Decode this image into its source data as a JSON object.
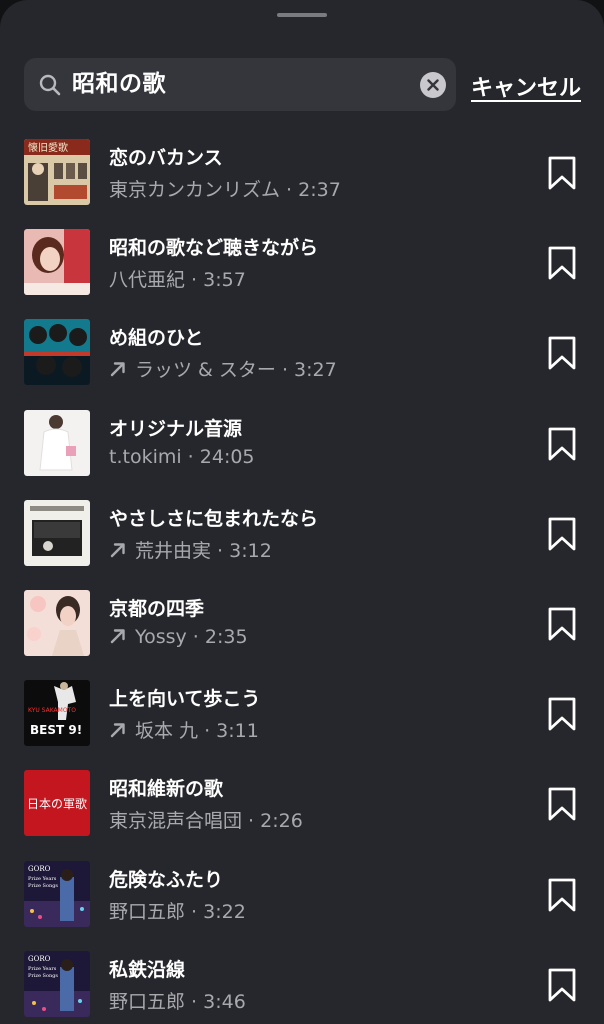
{
  "search": {
    "query": "昭和の歌",
    "cancel_label": "キャンセル"
  },
  "songs": [
    {
      "title": "恋のバカンス",
      "artist": "東京カンカンリズム",
      "duration": "2:37",
      "trending": false
    },
    {
      "title": "昭和の歌など聴きながら",
      "artist": "八代亜紀",
      "duration": "3:57",
      "trending": false
    },
    {
      "title": "め組のひと",
      "artist": "ラッツ & スター",
      "duration": "3:27",
      "trending": true
    },
    {
      "title": "オリジナル音源",
      "artist": "t.tokimi",
      "duration": "24:05",
      "trending": false
    },
    {
      "title": "やさしさに包まれたなら",
      "artist": "荒井由実",
      "duration": "3:12",
      "trending": true
    },
    {
      "title": "京都の四季",
      "artist": "Yossy",
      "duration": "2:35",
      "trending": true
    },
    {
      "title": "上を向いて歩こう",
      "artist": "坂本 九",
      "duration": "3:11",
      "trending": true
    },
    {
      "title": "昭和維新の歌",
      "artist": "東京混声合唱団",
      "duration": "2:26",
      "trending": false
    },
    {
      "title": "危険なふたり",
      "artist": "野口五郎",
      "duration": "3:22",
      "trending": false
    },
    {
      "title": "私鉄沿線",
      "artist": "野口五郎",
      "duration": "3:46",
      "trending": false
    }
  ],
  "cover_text": {
    "song1": "懐旧愛歌",
    "song7": [
      "KYU SAKAMOTO",
      "BEST 9!"
    ],
    "song8": "日本の軍歌",
    "song9": [
      "GORO",
      "Prize Years",
      "Prize Songs"
    ],
    "song10": [
      "GORO",
      "Prize Years",
      "Prize Songs"
    ]
  }
}
